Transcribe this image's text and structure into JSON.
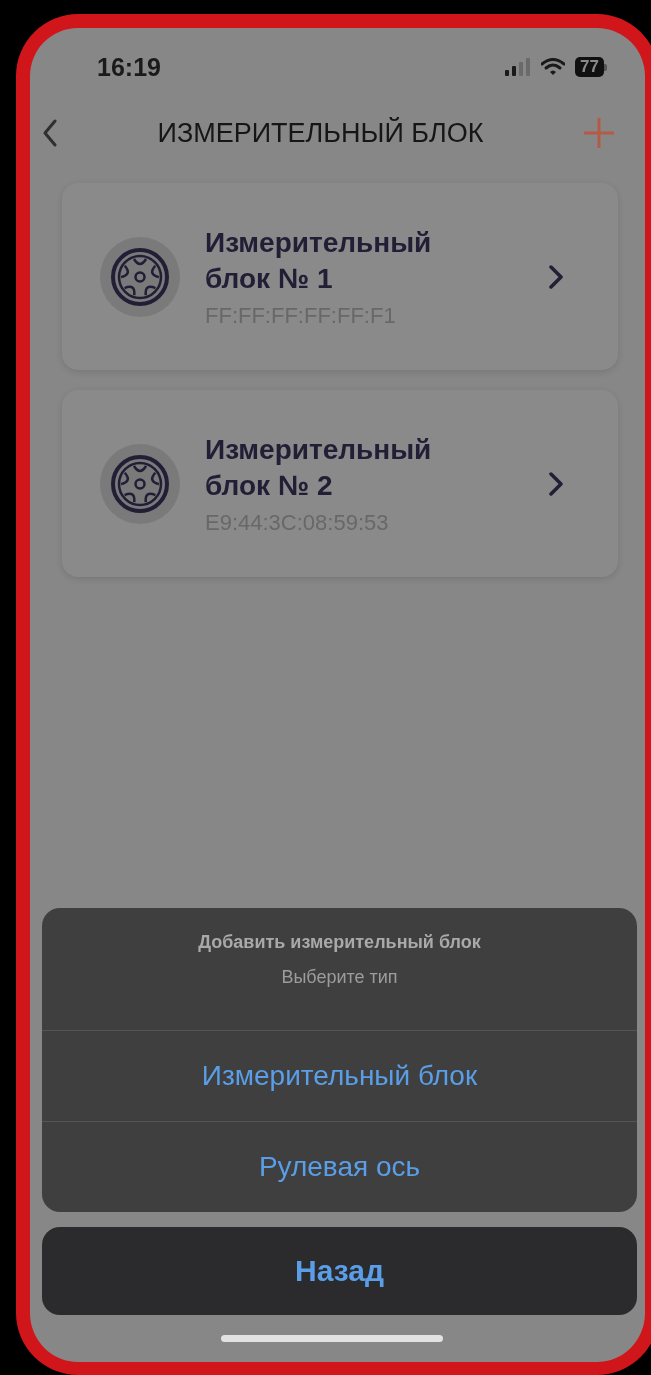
{
  "status_bar": {
    "time": "16:19",
    "battery": "77"
  },
  "header": {
    "title": "ИЗМЕРИТЕЛЬНЫЙ БЛОК"
  },
  "devices": [
    {
      "name": "Измерительный блок № 1",
      "address": "FF:FF:FF:FF:FF:F1"
    },
    {
      "name": "Измерительный блок № 2",
      "address": "E9:44:3C:08:59:53"
    }
  ],
  "action_sheet": {
    "title": "Добавить измерительный блок",
    "message": "Выберите тип",
    "actions": [
      "Измерительный блок",
      "Рулевая ось"
    ],
    "cancel": "Назад"
  }
}
